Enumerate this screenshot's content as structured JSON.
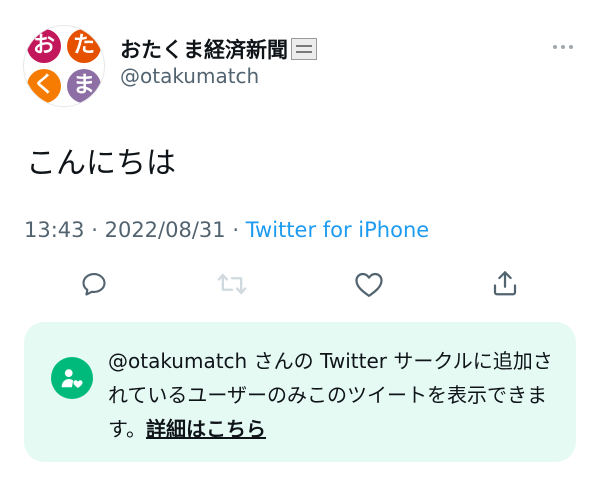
{
  "user": {
    "display_name": "おたくま経済新聞",
    "handle": "@otakumatch",
    "avatar_chars": [
      "お",
      "た",
      "く",
      "ま"
    ],
    "avatar_colors": [
      "#c2185b",
      "#e65100",
      "#f57c00",
      "#8e6fa5"
    ]
  },
  "tweet": {
    "text": "こんにちは",
    "time": "13:43",
    "separator": "·",
    "date": "2022/08/31",
    "source": "Twitter for iPhone"
  },
  "actions": [
    "reply-icon",
    "retweet-icon",
    "like-icon",
    "share-icon"
  ],
  "circle_notice": {
    "text": "@otakumatch さんの Twitter サークルに追加されているユーザーのみこのツイートを表示できます。",
    "link_label": "詳細はこちら",
    "accent_color": "#00ba7c",
    "background_color": "#e6faf4"
  },
  "colors": {
    "link": "#1d9bf0",
    "secondary_text": "#536471",
    "retweet_disabled": "#cfd9de"
  }
}
